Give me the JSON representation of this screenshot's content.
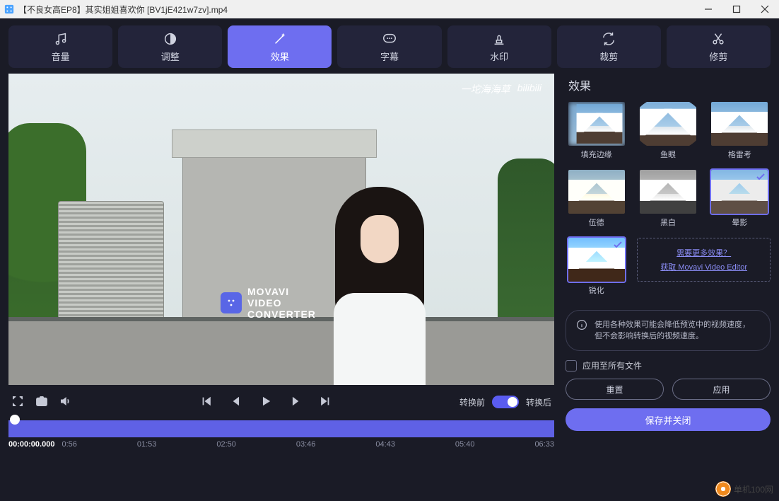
{
  "window": {
    "title": "【不良女高EP8】其实姐姐喜欢你 [BV1jE421w7zv].mp4"
  },
  "toolbar": {
    "volume": "音量",
    "adjust": "调整",
    "effects": "效果",
    "subtitles": "字幕",
    "watermark": "水印",
    "crop": "裁剪",
    "trim": "修剪"
  },
  "preview": {
    "watermark_line1": "MOVAVI",
    "watermark_line2": "VIDEO",
    "watermark_line3": "CONVERTER",
    "uploader": "一坨海海草",
    "site": "bilibili"
  },
  "controls": {
    "before_label": "转换前",
    "after_label": "转换后"
  },
  "timeline": {
    "current": "00:00:00.000",
    "ticks": [
      "0:56",
      "01:53",
      "02:50",
      "03:46",
      "04:43",
      "05:40",
      "06:33"
    ]
  },
  "panel": {
    "title": "效果",
    "effects": [
      {
        "id": "fill",
        "label": "填充边缘",
        "selected": false
      },
      {
        "id": "fish",
        "label": "鱼眼",
        "selected": false
      },
      {
        "id": "greco",
        "label": "格雷考",
        "selected": false
      },
      {
        "id": "wood",
        "label": "伍德",
        "selected": false
      },
      {
        "id": "bw",
        "label": "黑白",
        "selected": false
      },
      {
        "id": "glow",
        "label": "晕影",
        "selected": true
      },
      {
        "id": "sharp",
        "label": "锐化",
        "selected": true
      }
    ],
    "more_line1": "需要更多效果？",
    "more_line2": "获取 Movavi Video Editor",
    "notice_line1": "使用各种效果可能会降低预览中的视频速度，",
    "notice_line2": "但不会影响转换后的视频速度。",
    "apply_all": "应用至所有文件",
    "reset": "重置",
    "apply": "应用",
    "save_close": "保存并关闭"
  },
  "site_watermark": "单机100网"
}
